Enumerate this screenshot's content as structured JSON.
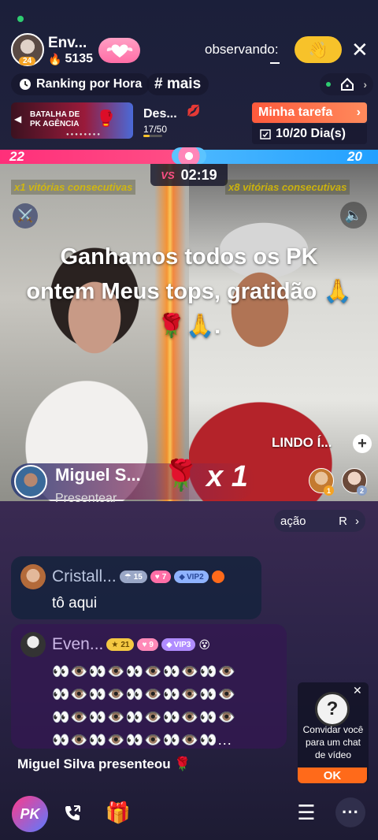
{
  "host": {
    "name": "Env...",
    "level": "24",
    "fans": "5135",
    "fans_icon": "flame-icon"
  },
  "viewers": {
    "label": "observando:"
  },
  "chips": {
    "ranking": "Ranking por Hora",
    "mais": "# mais"
  },
  "pk_banner": {
    "line1": "BATALHA DE",
    "line2": "PK AGÊNCIA"
  },
  "desafio": {
    "label": "Des...",
    "progress": "17/50",
    "progress_fraction": 0.34
  },
  "task": {
    "title": "Minha tarefa",
    "days": "10/20 Dia(s)"
  },
  "pk": {
    "score_left": "22",
    "score_right": "20",
    "vs": "VS",
    "timer": "02:19",
    "streak_left": "x1 vitórias consecutivas",
    "streak_right": "x8 vitórias consecutivas"
  },
  "overlay_message": "Ganhamos todos os PK ontem Meus tops, gratidão 🙏🌹🙏.",
  "opponent_label": "LINDO Í...",
  "gift": {
    "sender": "Miguel S...",
    "action": "Presentear",
    "item": "🌹",
    "multiplier": "x 1"
  },
  "top_rank": [
    "1",
    "2"
  ],
  "acao_chip": {
    "left": "ação",
    "right": "R"
  },
  "chat": [
    {
      "name": "Cristall...",
      "badges": [
        "15",
        "7",
        "VIP2"
      ],
      "text": "tô aqui"
    },
    {
      "name": "Even...",
      "badges": [
        "21",
        "9",
        "VIP3"
      ],
      "text": "👀👁️👀👁️👀👁️👀👁️👀👁️\n👀👁️👀👁️👀👁️👀👁️👀👁️\n👀👁️👀👁️👀👁️👀👁️👀👁️\n👀👁️👀👁️👀👁️👀👁️👀..."
    }
  ],
  "system_line": {
    "name": "Miguel Silva",
    "action": "presenteou",
    "item": "🌹"
  },
  "invite": {
    "text": "Convidar você para um chat de vídeo",
    "ok": "OK"
  },
  "bottom": {
    "pk": "PK"
  },
  "colors": {
    "pk_red": "#ff2f7a",
    "pk_blue": "#22a0ff",
    "task_orange": "#ff6a1a",
    "wave_yellow": "#f7c22a"
  }
}
